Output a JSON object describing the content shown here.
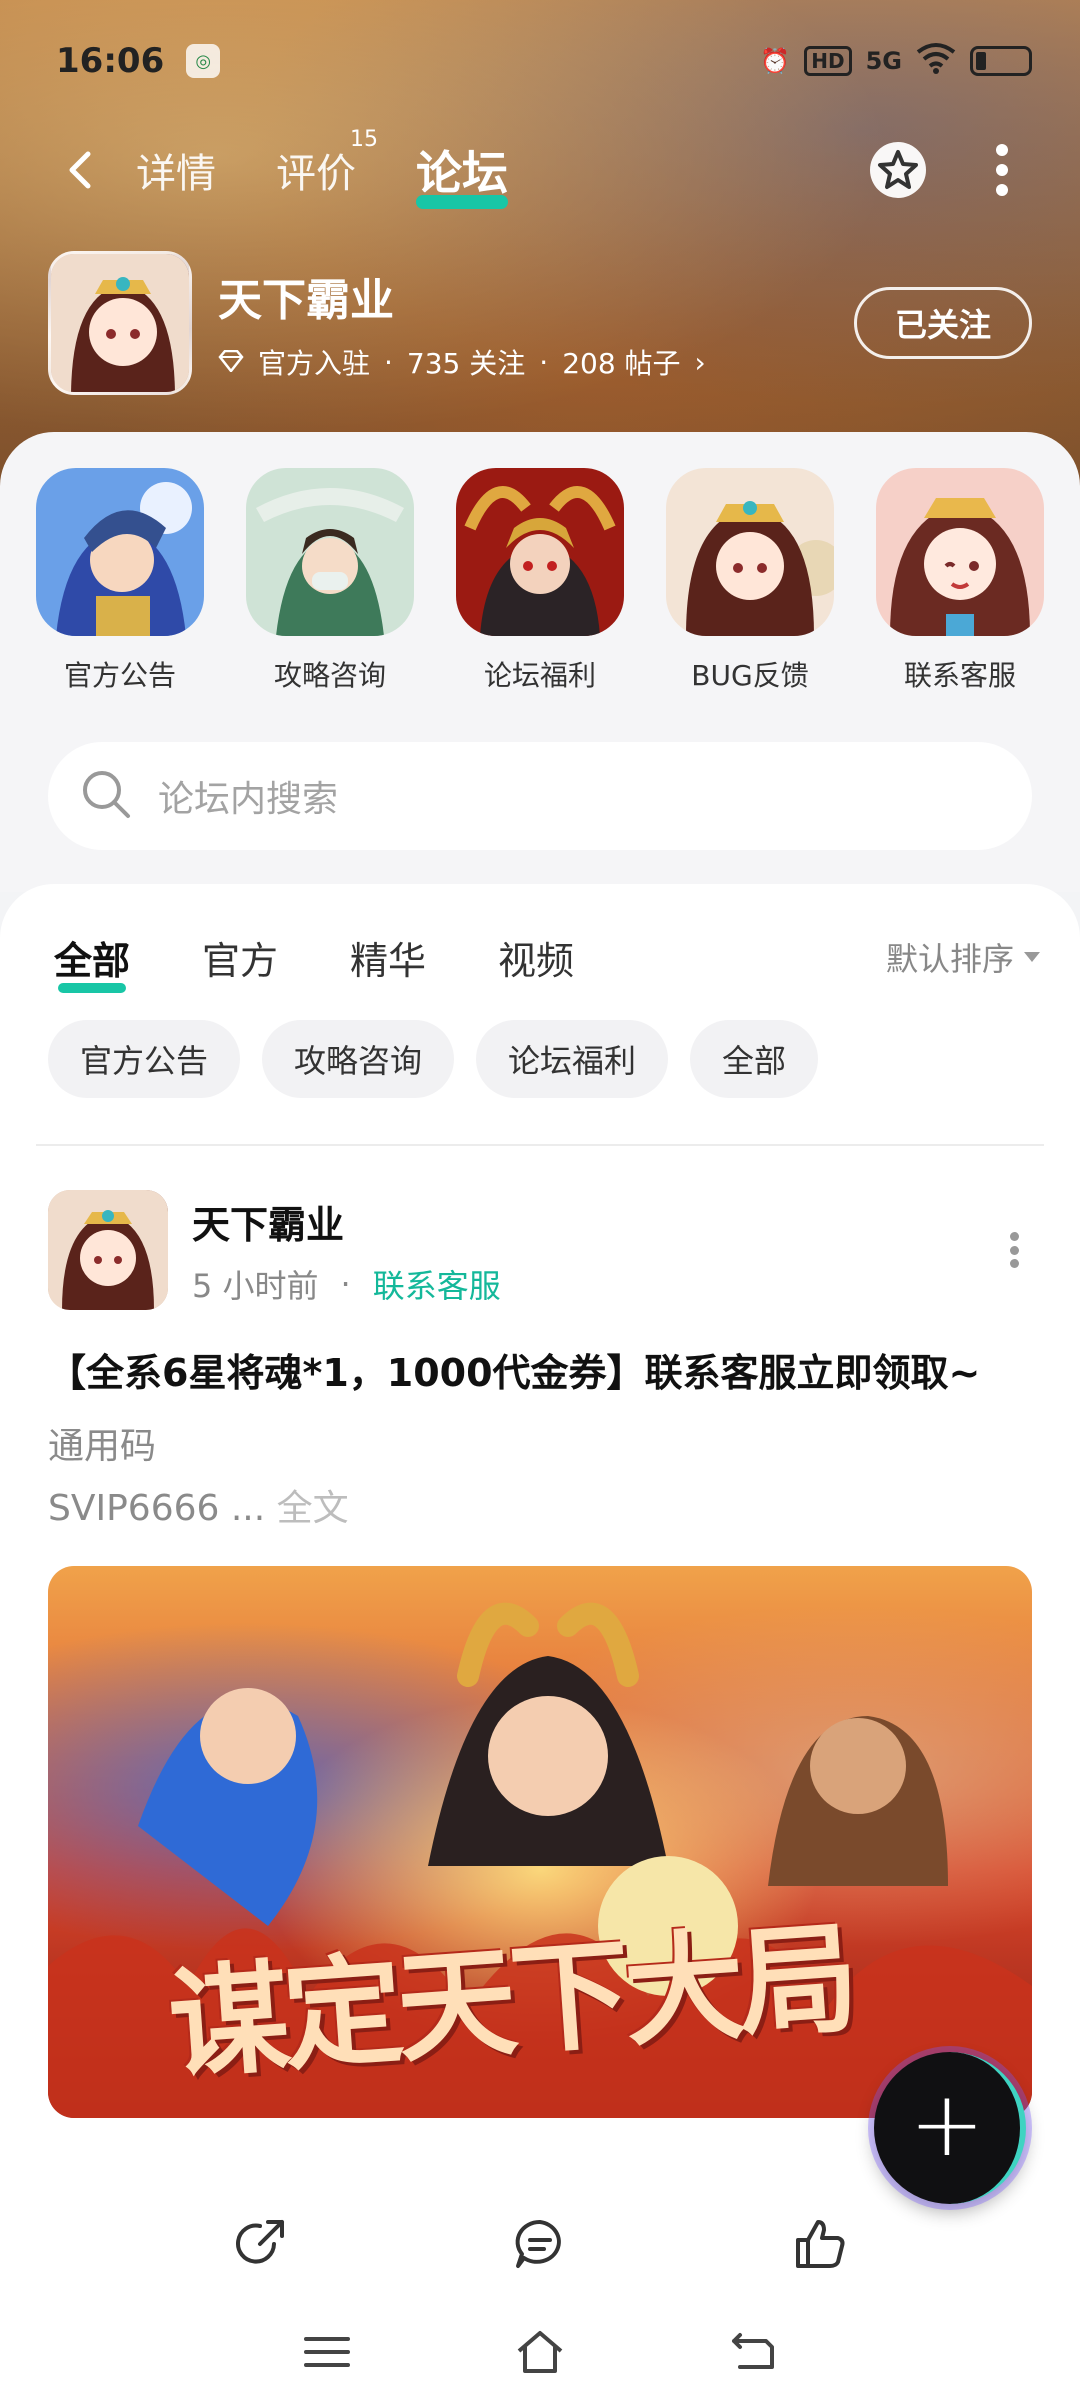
{
  "status_bar": {
    "time": "16:06",
    "network": "5G",
    "hd": "HD"
  },
  "topnav": {
    "tabs": [
      {
        "label": "详情",
        "badge": ""
      },
      {
        "label": "评价",
        "badge": "15"
      },
      {
        "label": "论坛",
        "badge": ""
      }
    ],
    "active_tab": "论坛"
  },
  "game": {
    "name": "天下霸业",
    "official": "官方入驻",
    "follows": "735 关注",
    "posts": "208 帖子",
    "follow_button": "已关注"
  },
  "quick_links": [
    {
      "label": "官方公告",
      "color": "#3d62c9"
    },
    {
      "label": "攻略咨询",
      "color": "#4f8c6a"
    },
    {
      "label": "论坛福利",
      "color": "#b52a1a"
    },
    {
      "label": "BUG反馈",
      "color": "#e0b7a4"
    },
    {
      "label": "联系客服",
      "color": "#e98b8f"
    }
  ],
  "search": {
    "placeholder": "论坛内搜索"
  },
  "feed_tabs": [
    "全部",
    "官方",
    "精华",
    "视频"
  ],
  "sort_label": "默认排序",
  "chips": [
    "官方公告",
    "攻略咨询",
    "论坛福利",
    "全部"
  ],
  "post": {
    "author": "天下霸业",
    "time": "5 小时前",
    "category": "联系客服",
    "title": "【全系6星将魂*1，1000代金券】联系客服立即领取~",
    "body_line1": "通用码",
    "body_line2": "SVIP6666 ...",
    "full_text_link": "全文",
    "image_text": "谋定天下大局"
  },
  "colors": {
    "accent": "#18c6a6",
    "category_text": "#14b89a"
  }
}
